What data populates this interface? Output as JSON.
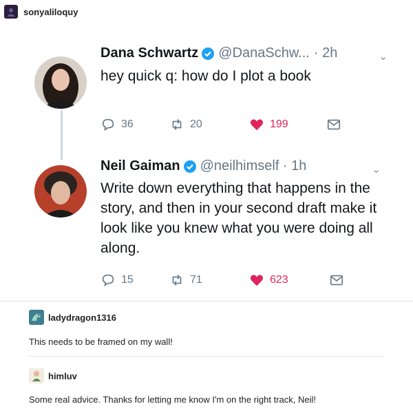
{
  "tumblr": {
    "username": "sonyaliloquy"
  },
  "tweets": [
    {
      "name": "Dana Schwartz",
      "handle": "@DanaSchw...",
      "time": "· 2h",
      "text": "hey quick q: how do I plot a book",
      "replies": "36",
      "retweets": "20",
      "likes": "199"
    },
    {
      "name": "Neil Gaiman",
      "handle": "@neilhimself · 1h",
      "text": "Write down everything that happens in the story, and then in your second draft make it look like you knew what you were doing all along.",
      "replies": "15",
      "retweets": "71",
      "likes": "623"
    }
  ],
  "comments": [
    {
      "username": "ladydragon1316",
      "text": "This needs to be framed on my wall!"
    },
    {
      "username": "himluv",
      "text": "Some real advice. Thanks for letting me know I'm on the right track, Neil!"
    }
  ],
  "colors": {
    "verified": "#1da1f2",
    "like": "#e0245e",
    "muted": "#657786"
  }
}
